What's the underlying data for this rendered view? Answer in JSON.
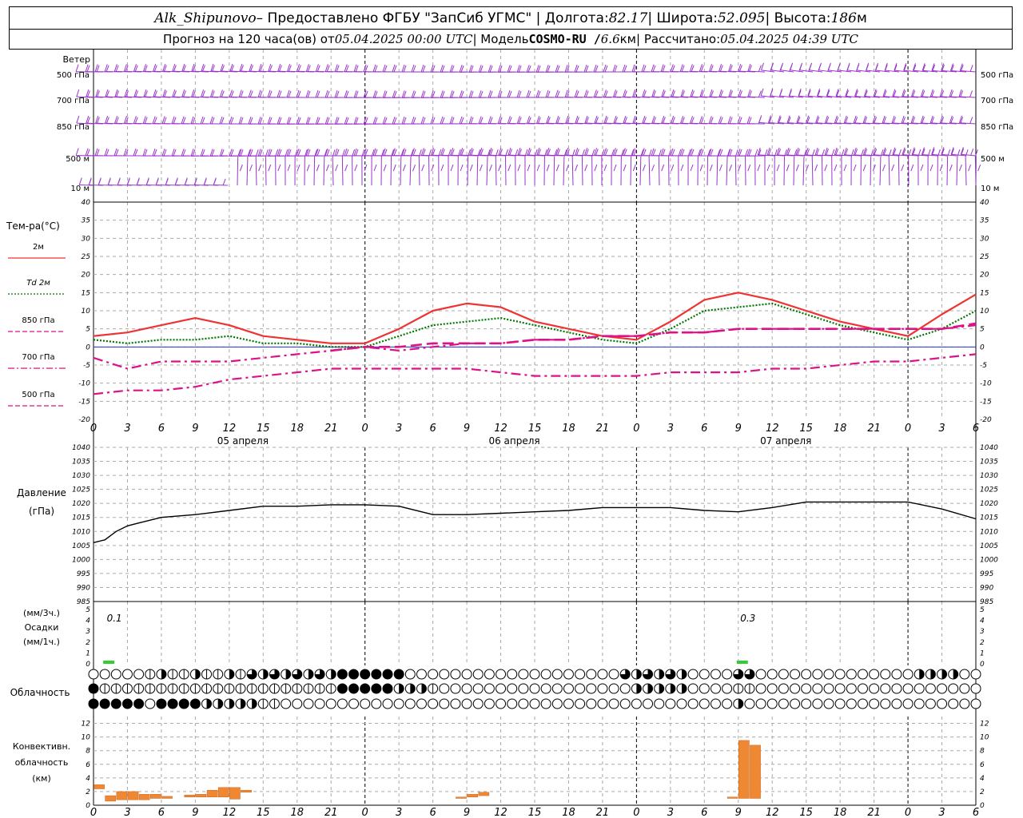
{
  "header": {
    "station": "Alk_Shipunovo",
    "provider": " – Предоставлено ФГБУ \"ЗапСиб УГМС\" | Долгота: ",
    "lon": "82.17",
    "lat_label": " | Широта: ",
    "lat": "52.095",
    "alt_label": " | Высота: ",
    "alt": "186",
    "alt_unit": "м",
    "forecast_label": "Прогноз на 120 часа(ов) от ",
    "forecast_from": "05.04.2025 00:00 UTC",
    "model_label": "  | Модель ",
    "model": "COSMO-RU / ",
    "resolution": "6.6",
    "res_unit": "км",
    "calc_label": " | Рассчитано: ",
    "calc_time": "05.04.2025 04:39 UTC"
  },
  "wind_panel": {
    "title": "Ветер",
    "levels": [
      "500 гПа",
      "700 гПа",
      "850 гПа",
      "500 м",
      "10 м"
    ],
    "barb_color": "#9933cc"
  },
  "temp_panel": {
    "title": "Тем-ра(°C)",
    "legend": [
      {
        "label": "2м",
        "color": "#ee3333",
        "dash": "solid"
      },
      {
        "label": "Td  2м",
        "color": "#007700",
        "dash": "dot"
      },
      {
        "label": "850 гПа",
        "color": "#dd1188",
        "dash": "dash"
      },
      {
        "label": "700 гПа",
        "color": "#dd1188",
        "dash": "dashdot"
      },
      {
        "label": "500 гПа",
        "color": "#dd1188",
        "dash": "dash"
      }
    ]
  },
  "pressure_panel": {
    "title": "Давление",
    "unit": "(гПа)"
  },
  "precip_panel": {
    "unit_top": "(мм/3ч.)",
    "title": "Осадки",
    "unit_bottom": "(мм/1ч.)",
    "annotations": [
      "0.1",
      "0.3"
    ]
  },
  "cloud_panel": {
    "title": "Облачность"
  },
  "conv_panel": {
    "title_lines": [
      "Конвективн.",
      "облачность",
      "(км)"
    ]
  },
  "time_axis": {
    "hour_labels": [
      "0",
      "3",
      "6",
      "9",
      "12",
      "15",
      "18",
      "21",
      "0",
      "3",
      "6",
      "9",
      "12",
      "15",
      "18",
      "21",
      "0",
      "3",
      "6",
      "9",
      "12",
      "15",
      "18",
      "21",
      "0",
      "3",
      "6"
    ],
    "day_labels": [
      "05 апреля",
      "06 апреля",
      "07 апреля"
    ]
  },
  "chart_data": [
    {
      "type": "line",
      "title": "Тем-ра(°C)",
      "x_hours": [
        0,
        3,
        6,
        9,
        12,
        15,
        18,
        21,
        24,
        27,
        30,
        33,
        36,
        39,
        42,
        45,
        48,
        51,
        54,
        57,
        60,
        63,
        66,
        69,
        72,
        75,
        78
      ],
      "ylim": [
        -20,
        40
      ],
      "series": [
        {
          "name": "2м",
          "values": [
            3,
            4,
            6,
            8,
            6,
            3,
            2,
            1,
            1,
            5,
            10,
            12,
            11,
            7,
            5,
            3,
            2,
            7,
            13,
            15,
            13,
            10,
            7,
            5,
            3,
            9,
            14.5
          ]
        },
        {
          "name": "Td  2м",
          "values": [
            2,
            1,
            2,
            2,
            3,
            1,
            1,
            0,
            0,
            3,
            6,
            7,
            8,
            6,
            4,
            2,
            1,
            5,
            10,
            11,
            12,
            9,
            6,
            4,
            2,
            5,
            10
          ]
        },
        {
          "name": "850 гПа",
          "values": [
            null,
            null,
            null,
            null,
            null,
            null,
            null,
            -1,
            0,
            0,
            1,
            1,
            1,
            2,
            2,
            3,
            3,
            4,
            4,
            5,
            5,
            5,
            5,
            5,
            5,
            5,
            6.5
          ]
        },
        {
          "name": "700 гПа",
          "values": [
            -3,
            -6,
            -4,
            -4,
            -4,
            -3,
            -2,
            -1,
            0,
            -1,
            0,
            1,
            1,
            2,
            2,
            3,
            3,
            4,
            4,
            5,
            5,
            5,
            5,
            5,
            5,
            5,
            6
          ]
        },
        {
          "name": "500 гПа",
          "values": [
            -13,
            -12,
            -12,
            -11,
            -9,
            -8,
            -7,
            -6,
            -6,
            -6,
            -6,
            -6,
            -7,
            -8,
            -8,
            -8,
            -8,
            -7,
            -7,
            -7,
            -6,
            -6,
            -5,
            -4,
            -4,
            -3,
            -2
          ]
        }
      ]
    },
    {
      "type": "line",
      "title": "Давление",
      "x_hours": [
        0,
        1,
        2,
        3,
        4,
        6,
        9,
        12,
        15,
        18,
        21,
        24,
        27,
        30,
        33,
        36,
        39,
        42,
        45,
        48,
        51,
        54,
        57,
        60,
        63,
        66,
        69,
        72,
        75,
        78
      ],
      "ylim": [
        985,
        1040
      ],
      "series": [
        {
          "name": "Давление",
          "values": [
            1006,
            1007,
            1010,
            1012,
            1013,
            1015,
            1016,
            1017.5,
            1019,
            1019,
            1019.5,
            1019.5,
            1019,
            1016,
            1016,
            1016.5,
            1017,
            1017.5,
            1018.5,
            1018.5,
            1018.5,
            1017.5,
            1017,
            1018.5,
            1020.5,
            1020.5,
            1020.5,
            1020.5,
            1018,
            1014.5
          ]
        }
      ]
    },
    {
      "type": "bar",
      "title": "Осадки",
      "x_hours": [
        1,
        57
      ],
      "ylim": [
        0,
        5
      ],
      "values": [
        0.1,
        0.3
      ]
    },
    {
      "type": "bar",
      "title": "Конвективн. облачность (км)",
      "ylim": [
        0,
        13
      ],
      "bars": [
        {
          "x": 0,
          "bottom": 2.4,
          "top": 3.0
        },
        {
          "x": 1,
          "bottom": 0.6,
          "top": 1.4
        },
        {
          "x": 2,
          "bottom": 0.8,
          "top": 2.0
        },
        {
          "x": 3,
          "bottom": 0.8,
          "top": 2.0
        },
        {
          "x": 4,
          "bottom": 0.8,
          "top": 1.6
        },
        {
          "x": 5,
          "bottom": 1.0,
          "top": 1.6
        },
        {
          "x": 6,
          "bottom": 1.0,
          "top": 1.3
        },
        {
          "x": 8,
          "bottom": 1.2,
          "top": 1.5
        },
        {
          "x": 9,
          "bottom": 1.2,
          "top": 1.6
        },
        {
          "x": 10,
          "bottom": 1.2,
          "top": 2.2
        },
        {
          "x": 11,
          "bottom": 1.2,
          "top": 2.6
        },
        {
          "x": 12,
          "bottom": 0.9,
          "top": 2.6
        },
        {
          "x": 13,
          "bottom": 1.9,
          "top": 2.2
        },
        {
          "x": 32,
          "bottom": 1.0,
          "top": 1.2
        },
        {
          "x": 33,
          "bottom": 1.2,
          "top": 1.6
        },
        {
          "x": 34,
          "bottom": 1.4,
          "top": 1.9
        },
        {
          "x": 56,
          "bottom": 1.0,
          "top": 1.2
        },
        {
          "x": 57,
          "bottom": 1.0,
          "top": 9.5
        },
        {
          "x": 58,
          "bottom": 1.0,
          "top": 8.8
        }
      ]
    }
  ]
}
